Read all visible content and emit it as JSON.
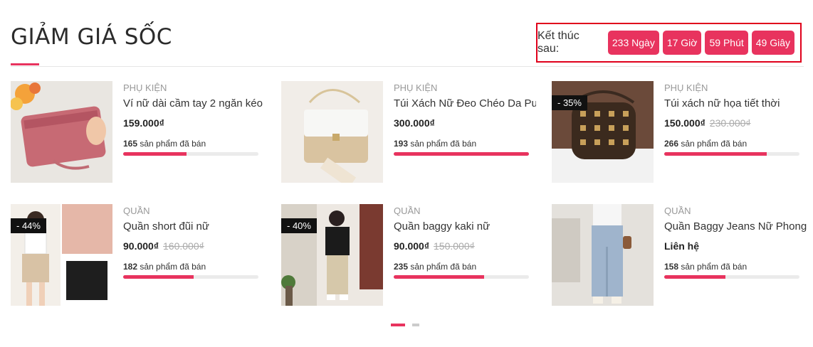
{
  "section": {
    "title": "GIẢM GIÁ SỐC"
  },
  "countdown": {
    "label": "Kết thúc sau:",
    "days": "233 Ngày",
    "hours": "17 Giờ",
    "minutes": "59 Phút",
    "seconds": "49 Giây"
  },
  "colors": {
    "accent": "#e8335e",
    "highlight_border": "#e0001b"
  },
  "products": [
    {
      "category": "PHỤ KIỆN",
      "name": "Ví nữ dài cầm tay 2 ngăn kéo",
      "price": "159.000₫",
      "old_price": "",
      "badge": "",
      "sold_count": "165",
      "sold_text": "sản phẩm đã bán",
      "sold_fraction": 0.47
    },
    {
      "category": "PHỤ KIỆN",
      "name": "Túi Xách Nữ Đeo Chéo Da Pu",
      "price": "300.000₫",
      "old_price": "",
      "badge": "",
      "sold_count": "193",
      "sold_text": "sản phẩm đã bán",
      "sold_fraction": 1.0
    },
    {
      "category": "PHỤ KIỆN",
      "name": "Túi xách nữ họa tiết thời",
      "price": "150.000₫",
      "old_price": "230.000₫",
      "badge": "- 35%",
      "sold_count": "266",
      "sold_text": "sản phẩm đã bán",
      "sold_fraction": 0.76
    },
    {
      "category": "QUẦN",
      "name": "Quần short đũi nữ",
      "price": "90.000₫",
      "old_price": "160.000₫",
      "badge": "- 44%",
      "sold_count": "182",
      "sold_text": "sản phẩm đã bán",
      "sold_fraction": 0.52
    },
    {
      "category": "QUẦN",
      "name": "Quần baggy kaki nữ",
      "price": "90.000₫",
      "old_price": "150.000₫",
      "badge": "- 40%",
      "sold_count": "235",
      "sold_text": "sản phẩm đã bán",
      "sold_fraction": 0.67
    },
    {
      "category": "QUẦN",
      "name": "Quần Baggy Jeans Nữ Phong",
      "price": "Liên hệ",
      "old_price": "",
      "badge": "",
      "sold_count": "158",
      "sold_text": "sản phẩm đã bán",
      "sold_fraction": 0.45
    }
  ],
  "pagination": {
    "pages": 2,
    "active": 1
  }
}
